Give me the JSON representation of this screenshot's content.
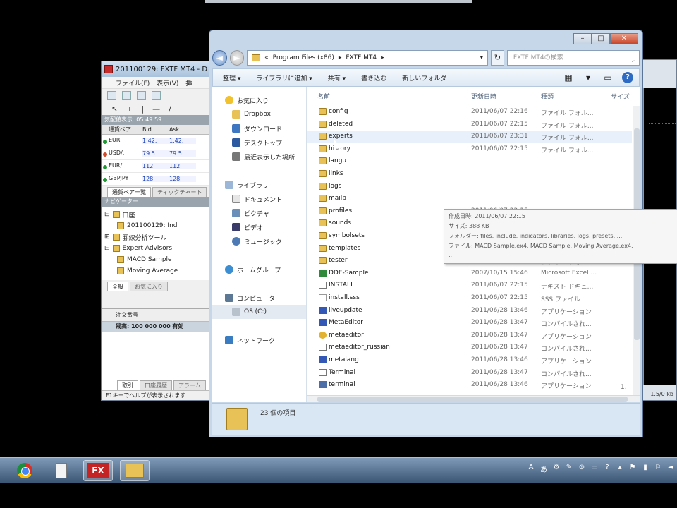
{
  "mt4": {
    "title": "201100129: FXTF MT4 - D",
    "menu": [
      "ファイル(F)",
      "表示(V)",
      "挿"
    ],
    "market_watch_title": "気配値表示: 05:49:59",
    "mw_columns": [
      "通貨ペア",
      "Bid",
      "Ask"
    ],
    "mw_rows": [
      {
        "symbol": "EUR.",
        "bid": "1.42.",
        "ask": "1.42.",
        "color": "#1f9a33"
      },
      {
        "symbol": "USD/.",
        "bid": "79.5.",
        "ask": "79.5.",
        "color": "#d04a2a"
      },
      {
        "symbol": "EUR/.",
        "bid": "112.",
        "ask": "112.",
        "color": "#1f9a33"
      },
      {
        "symbol": "GBPJPY",
        "bid": "128.",
        "ask": "128.",
        "color": "#1f9a33"
      }
    ],
    "mw_tabs": [
      "通貨ペア一覧",
      "ティックチャート"
    ],
    "navigator_title": "ナビゲーター",
    "nav_items": [
      "口座",
      "201100129: Ind",
      "罫線分析ツール",
      "Expert Advisors",
      "MACD Sample",
      "Moving Average"
    ],
    "nav_tabs": [
      "全般",
      "お気に入り"
    ],
    "term_header": "注文番号",
    "term_row": "残高: 100 000 000  有効",
    "term_tabs": [
      "取引",
      "口座履歴",
      "アラーム"
    ],
    "status": "F1キーでヘルプが表示されます"
  },
  "chart": {
    "status_right": "1.5/0 kb"
  },
  "explorer": {
    "breadcrumb": [
      "«",
      "Program Files (x86)",
      "▸",
      "FXTF MT4",
      "▸"
    ],
    "search_placeholder": "FXTF MT4の検索",
    "commands": [
      "整理 ▾",
      "ライブラリに追加 ▾",
      "共有 ▾",
      "書き込む",
      "新しいフォルダー"
    ],
    "nav_pane": {
      "favorites": "お気に入り",
      "fav_items": [
        "Dropbox",
        "ダウンロード",
        "デスクトップ",
        "最近表示した場所"
      ],
      "libraries": "ライブラリ",
      "lib_items": [
        "ドキュメント",
        "ピクチャ",
        "ビデオ",
        "ミュージック"
      ],
      "homegroup": "ホームグループ",
      "computer": "コンピューター",
      "drive": "OS (C:)",
      "network": "ネットワーク"
    },
    "columns": [
      "名前",
      "更新日時",
      "種類",
      "サイズ"
    ],
    "files": [
      {
        "name": "config",
        "date": "2011/06/07 22:16",
        "type": "ファイル フォル...",
        "icon": "folder"
      },
      {
        "name": "deleted",
        "date": "2011/06/07 22:15",
        "type": "ファイル フォル...",
        "icon": "folder"
      },
      {
        "name": "experts",
        "date": "2011/06/07 23:31",
        "type": "ファイル フォル...",
        "icon": "folder"
      },
      {
        "name": "history",
        "date": "2011/06/07 22:15",
        "type": "ファイル フォル...",
        "icon": "folder"
      },
      {
        "name": "langu",
        "date": "",
        "type": "",
        "icon": "folder"
      },
      {
        "name": "links",
        "date": "",
        "type": "",
        "icon": "folder"
      },
      {
        "name": "logs",
        "date": "",
        "type": "",
        "icon": "folder"
      },
      {
        "name": "mailb",
        "date": "",
        "type": "",
        "icon": "folder"
      },
      {
        "name": "profiles",
        "date": "2011/06/07 22:15",
        "type": "ファイル フォル...",
        "icon": "folder"
      },
      {
        "name": "sounds",
        "date": "2011/06/07 22:15",
        "type": "ファイル フォル...",
        "icon": "folder"
      },
      {
        "name": "symbolsets",
        "date": "2011/06/07 22:15",
        "type": "ファイル フォル...",
        "icon": "folder"
      },
      {
        "name": "templates",
        "date": "2011/06/07 22:15",
        "type": "ファイル フォル...",
        "icon": "folder"
      },
      {
        "name": "tester",
        "date": "2011/06/07 22:15",
        "type": "ファイル フォル...",
        "icon": "folder"
      },
      {
        "name": "DDE-Sample",
        "date": "2007/10/15 15:46",
        "type": "Microsoft Excel ...",
        "icon": "xls"
      },
      {
        "name": "INSTALL",
        "date": "2011/06/07 22:15",
        "type": "テキスト ドキュ...",
        "icon": "txt"
      },
      {
        "name": "install.sss",
        "date": "2011/06/07 22:15",
        "type": "SSS ファイル",
        "icon": "sss"
      },
      {
        "name": "liveupdate",
        "date": "2011/06/28 13:46",
        "type": "アプリケーション",
        "icon": "exe"
      },
      {
        "name": "MetaEditor",
        "date": "2011/06/28 13:47",
        "type": "コンパイルされ...",
        "icon": "exe"
      },
      {
        "name": "metaeditor",
        "date": "2011/06/28 13:47",
        "type": "アプリケーション",
        "icon": "mq"
      },
      {
        "name": "metaeditor_russian",
        "date": "2011/06/28 13:47",
        "type": "コンパイルされ...",
        "icon": "txt"
      },
      {
        "name": "metalang",
        "date": "2011/06/28 13:46",
        "type": "アプリケーション",
        "icon": "exe"
      },
      {
        "name": "Terminal",
        "date": "2011/06/28 13:47",
        "type": "コンパイルされ...",
        "icon": "txt"
      },
      {
        "name": "terminal",
        "date": "2011/06/28 13:46",
        "type": "アプリケーション",
        "icon": "term"
      }
    ],
    "last_row_size": "1,",
    "tooltip": [
      "作成日時: 2011/06/07 22:15",
      "サイズ: 388 KB",
      "フォルダー: files, include, indicators, libraries, logs, presets, ...",
      "ファイル: MACD Sample.ex4, MACD Sample, Moving Average.ex4,",
      "..."
    ],
    "item_count": "23 個の項目"
  },
  "taskbar": {
    "items": [
      "chrome-icon",
      "document-icon",
      "fx-icon",
      "explorer-icon"
    ],
    "fx_label": "FX",
    "tray": [
      "A",
      "あ",
      "⚙",
      "✎",
      "⊙",
      "▭",
      "?",
      "▴",
      "⚑",
      "▮",
      "⚐",
      "◄"
    ]
  }
}
